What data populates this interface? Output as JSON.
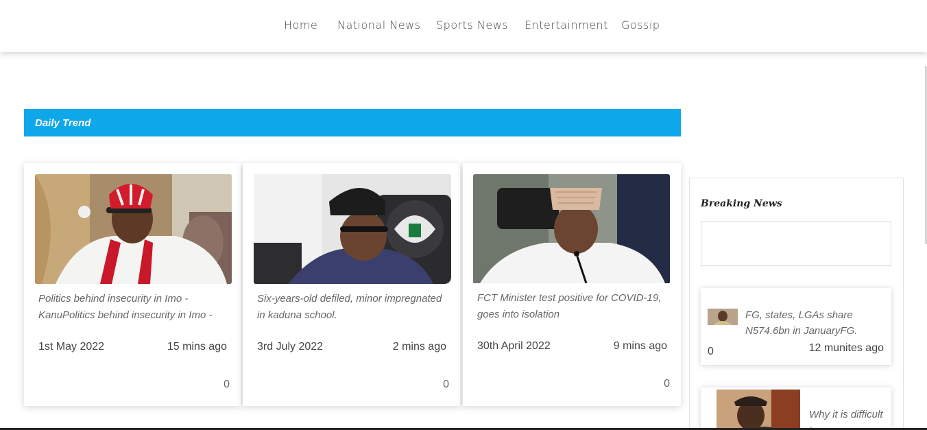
{
  "nav": {
    "items": [
      {
        "label": "Home"
      },
      {
        "label": "National News"
      },
      {
        "label": "Sports News"
      },
      {
        "label": "Entertainment"
      },
      {
        "label": "Gossip"
      }
    ]
  },
  "trend": {
    "title": "Daily Trend",
    "color": "#0ea7ea"
  },
  "cards": [
    {
      "headline": "Politics behind insecurity in Imo - KanuPolitics behind insecurity in Imo -",
      "date": "1st May 2022",
      "ago": "15 mins ago",
      "count": "0",
      "image": "man-in-red-cap-photo"
    },
    {
      "headline": "Six-years-old defiled, minor impregnated in kaduna school.",
      "date": "3rd July 2022",
      "ago": "2 mins ago",
      "count": "0",
      "image": "man-in-black-cap-photo"
    },
    {
      "headline": "FCT Minister test positive for COVID-19, goes into isolation",
      "date": "30th April 2022",
      "ago": "9 mins ago",
      "count": "0",
      "image": "man-in-white-cap-photo"
    }
  ],
  "sidebar": {
    "title": "Breaking News",
    "items": [
      {
        "headline": "FG, states, LGAs share N574.6bn in JanuaryFG.",
        "count": "0",
        "ago": "12 munites ago",
        "image": "official-thumbnail"
      },
      {
        "headline": "Why it is difficult t",
        "image": "man-in-hat-thumbnail"
      }
    ]
  }
}
